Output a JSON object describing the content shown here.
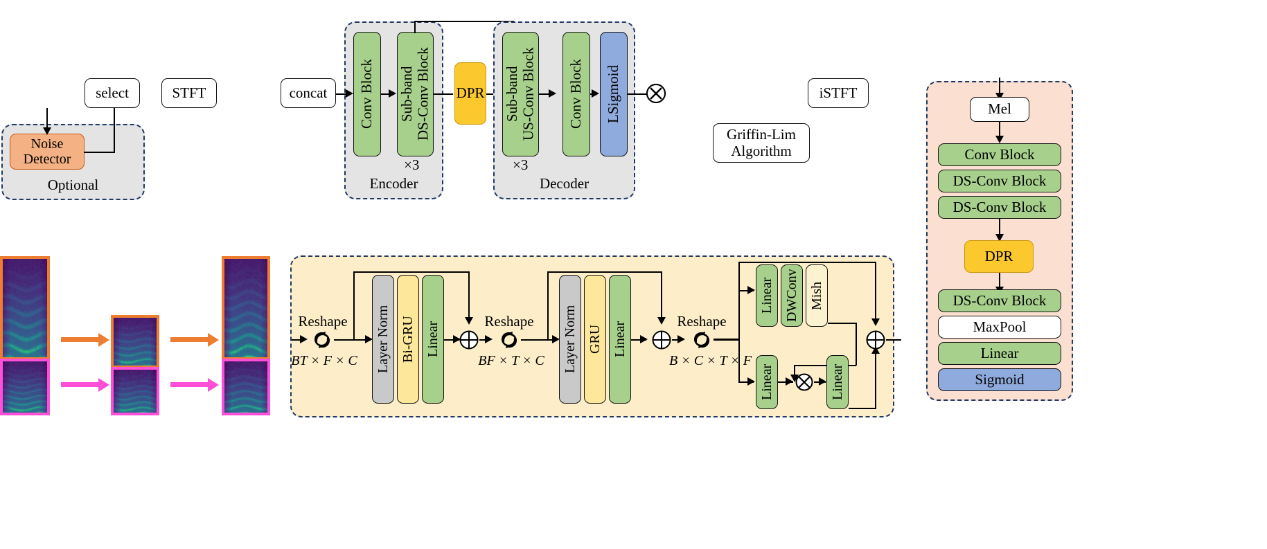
{
  "title": "Speech enhancement / vocoder pipeline block diagram",
  "top_flow": {
    "select": "select",
    "stft": "STFT",
    "concat": "concat",
    "istft": "iSTFT",
    "griffin_lim": "Griffin-Lim\nAlgorithm",
    "multiply_op": "multiply-op"
  },
  "optional_group": {
    "label": "Optional",
    "noise_detector": "Noise\nDetector"
  },
  "encoder": {
    "label": "Encoder",
    "repeat": "×3",
    "blocks": [
      {
        "text": "Conv Block",
        "color": "green"
      },
      {
        "text": "Sub-band\nDS-Conv Block",
        "color": "green"
      }
    ]
  },
  "dpr_main": {
    "label": "DPR"
  },
  "decoder": {
    "label": "Decoder",
    "repeat": "×3",
    "blocks": [
      {
        "text": "Sub-band\nUS-Conv Block",
        "color": "green"
      },
      {
        "text": "Conv Block",
        "color": "green"
      },
      {
        "text": "LSigmoid",
        "color": "blue"
      }
    ]
  },
  "dpr_detail": {
    "stage1": {
      "reshape_label": "Reshape",
      "dim_label": "BT × F × C",
      "blocks": [
        {
          "text": "Layer Norm",
          "color": "grey"
        },
        {
          "text": "Bi-GRU",
          "color": "lyellow"
        },
        {
          "text": "Linear",
          "color": "green"
        }
      ],
      "add_op": "add-op"
    },
    "stage2": {
      "reshape_label": "Reshape",
      "dim_label": "BF × T × C",
      "blocks": [
        {
          "text": "Layer Norm",
          "color": "grey"
        },
        {
          "text": "GRU",
          "color": "lyellow"
        },
        {
          "text": "Linear",
          "color": "green"
        }
      ],
      "add_op": "add-op"
    },
    "stage3": {
      "reshape_label": "Reshape",
      "dim_label": "B × C × T × F",
      "top_branch": [
        {
          "text": "Linear",
          "color": "green"
        },
        {
          "text": "DWConv",
          "color": "green"
        },
        {
          "text": "Mish",
          "color": "cream"
        }
      ],
      "bottom_branch": [
        {
          "text": "Linear",
          "color": "green"
        },
        {
          "text": "Linear",
          "color": "green"
        }
      ],
      "mul_op": "multiply-op",
      "add_op": "add-op"
    }
  },
  "mel_branch": {
    "blocks": [
      {
        "text": "Mel",
        "color": "white"
      },
      {
        "text": "Conv Block",
        "color": "green"
      },
      {
        "text": "DS-Conv Block",
        "color": "green"
      },
      {
        "text": "DS-Conv Block",
        "color": "green"
      },
      {
        "text": "DPR",
        "color": "yellow"
      },
      {
        "text": "DS-Conv Block",
        "color": "green"
      },
      {
        "text": "MaxPool",
        "color": "white"
      },
      {
        "text": "Linear",
        "color": "green"
      },
      {
        "text": "Sigmoid",
        "color": "blue"
      }
    ]
  },
  "spectrograms": {
    "row_orange_label": "orange-path",
    "row_pink_label": "pink-path",
    "tiles": [
      {
        "name": "input-spectrogram-orange",
        "border": "orange"
      },
      {
        "name": "mid-spectrogram-orange",
        "border": "orange"
      },
      {
        "name": "output-spectrogram-orange",
        "border": "orange"
      },
      {
        "name": "input-spectrogram-pink",
        "border": "pink"
      },
      {
        "name": "mid-spectrogram-pink",
        "border": "pink"
      },
      {
        "name": "output-spectrogram-pink",
        "border": "pink"
      }
    ]
  },
  "colors": {
    "green": "#a8d08d",
    "yellow": "#fbc92e",
    "blue": "#8faadc",
    "orange": "#f4b183",
    "grey_group": "#e4e4e4",
    "cream_group": "#fdeec9",
    "peach_group": "#fbe0d2",
    "dash_border": "#1f3864",
    "arrow_orange": "#ED7D31",
    "arrow_pink": "#FF4FD8"
  }
}
